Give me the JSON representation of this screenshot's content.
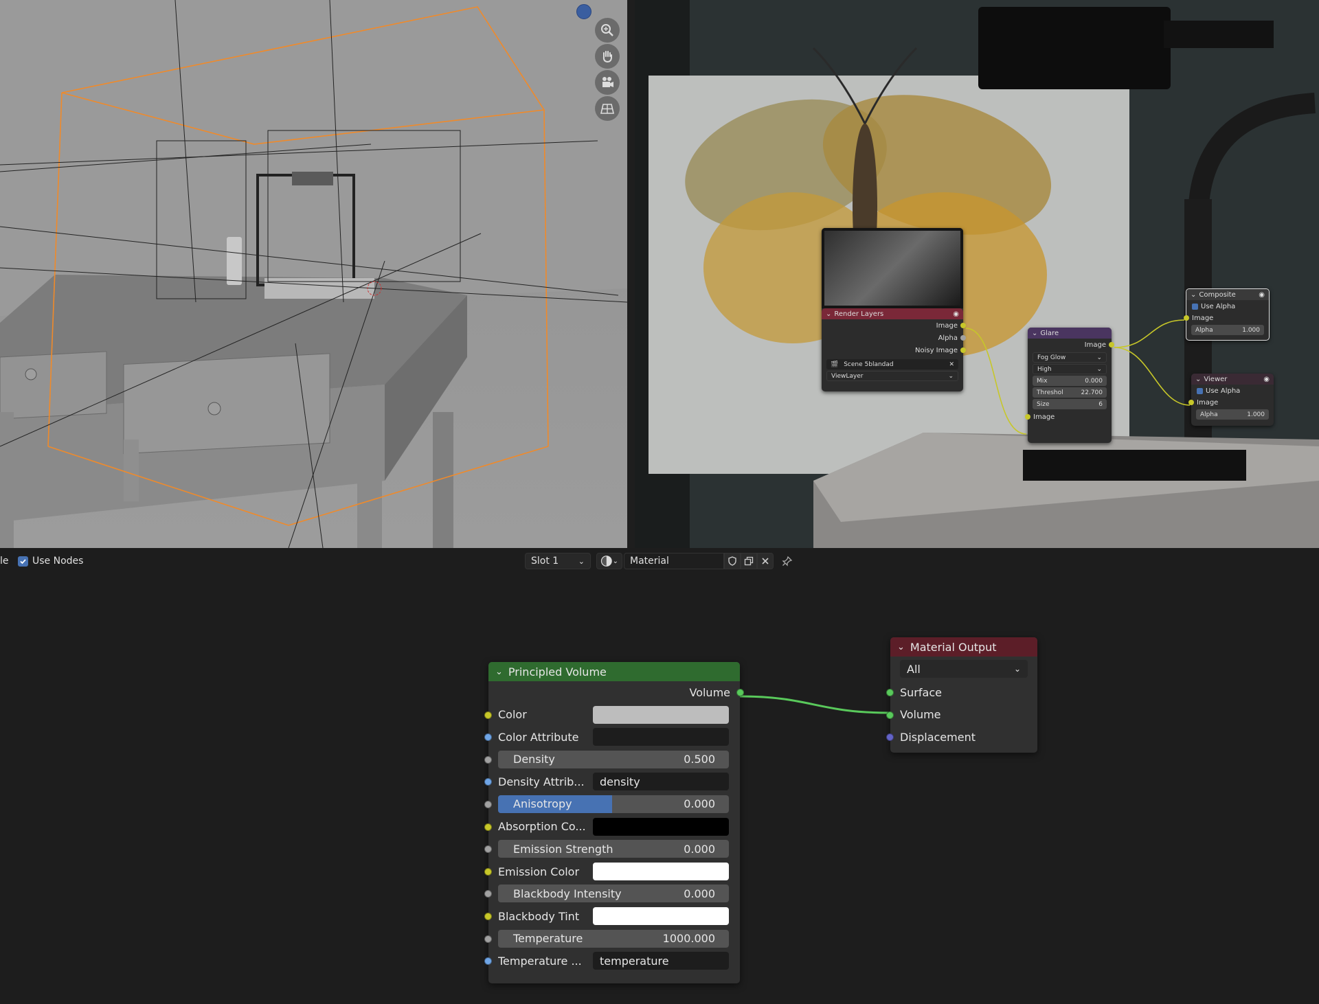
{
  "header": {
    "cut_label": "le",
    "use_nodes_label": "Use Nodes",
    "slot_label": "Slot 1",
    "material_name": "Material"
  },
  "compositor": {
    "render_layers": {
      "title": "Render Layers",
      "outputs": [
        "Image",
        "Alpha",
        "Noisy Image"
      ],
      "scene": "Scene 5blandad",
      "view_layer": "ViewLayer"
    },
    "glare": {
      "title": "Glare",
      "output": "Image",
      "type": "Fog Glow",
      "quality": "High",
      "mix_label": "Mix",
      "mix_value": "0.000",
      "threshold_label": "Threshol",
      "threshold_value": "22.700",
      "size_label": "Size",
      "size_value": "6",
      "input": "Image"
    },
    "composite": {
      "title": "Composite",
      "use_alpha": "Use Alpha",
      "input": "Image",
      "alpha_label": "Alpha",
      "alpha_value": "1.000"
    },
    "viewer": {
      "title": "Viewer",
      "use_alpha": "Use Alpha",
      "input": "Image",
      "alpha_label": "Alpha",
      "alpha_value": "1.000"
    }
  },
  "shader": {
    "principled_volume": {
      "title": "Principled Volume",
      "output": "Volume",
      "color_label": "Color",
      "color_attr_label": "Color Attribute",
      "density_label": "Density",
      "density_value": "0.500",
      "density_attr_label": "Density Attrib...",
      "density_attr_value": "density",
      "anisotropy_label": "Anisotropy",
      "anisotropy_value": "0.000",
      "absorption_label": "Absorption Co...",
      "emission_strength_label": "Emission Strength",
      "emission_strength_value": "0.000",
      "emission_color_label": "Emission Color",
      "blackbody_intensity_label": "Blackbody Intensity",
      "blackbody_intensity_value": "0.000",
      "blackbody_tint_label": "Blackbody Tint",
      "temperature_label": "Temperature",
      "temperature_value": "1000.000",
      "temperature_attr_label": "Temperature ...",
      "temperature_attr_value": "temperature"
    },
    "material_output": {
      "title": "Material Output",
      "target": "All",
      "surface": "Surface",
      "volume": "Volume",
      "displacement": "Displacement"
    }
  },
  "colors": {
    "volume_header": "#2f6b2f",
    "output_header": "#5c1e28",
    "render_layers_header": "#7a2838",
    "glare_header": "#4a3560",
    "accent": "#4772b3"
  },
  "icons": [
    "zoom-icon",
    "hand-pan-icon",
    "camera-icon",
    "grid-ortho-icon",
    "shield-icon",
    "duplicate-icon",
    "close-icon",
    "pin-icon",
    "material-sphere-icon"
  ]
}
